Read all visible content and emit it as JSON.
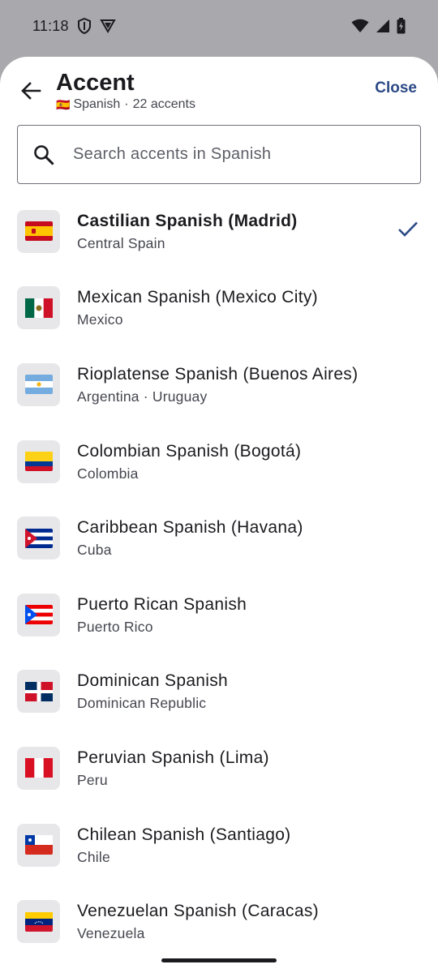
{
  "status_bar": {
    "time": "11:18",
    "icons": [
      "shield-icon",
      "vpn-icon",
      "wifi-icon",
      "cellular-signal-icon",
      "battery-icon"
    ]
  },
  "header": {
    "title": "Accent",
    "subtitle_flag": "🇪🇸",
    "subtitle_language": "Spanish",
    "subtitle_separator": "·",
    "subtitle_count": "22 accents",
    "close_label": "Close",
    "back_icon": "arrow-left-icon"
  },
  "search": {
    "placeholder": "Search accents in Spanish",
    "icon": "search-icon"
  },
  "accents": [
    {
      "flag": "es",
      "name": "Castilian Spanish (Madrid)",
      "region": "Central Spain",
      "selected": true
    },
    {
      "flag": "mx",
      "name": "Mexican Spanish (Mexico City)",
      "region": "Mexico",
      "selected": false
    },
    {
      "flag": "ar",
      "name": "Rioplatense Spanish (Buenos Aires)",
      "region": "Argentina · Uruguay",
      "selected": false
    },
    {
      "flag": "co",
      "name": "Colombian Spanish (Bogotá)",
      "region": "Colombia",
      "selected": false
    },
    {
      "flag": "cu",
      "name": "Caribbean Spanish (Havana)",
      "region": "Cuba",
      "selected": false
    },
    {
      "flag": "pr",
      "name": "Puerto Rican Spanish",
      "region": "Puerto Rico",
      "selected": false
    },
    {
      "flag": "do",
      "name": "Dominican Spanish",
      "region": "Dominican Republic",
      "selected": false
    },
    {
      "flag": "pe",
      "name": "Peruvian Spanish (Lima)",
      "region": "Peru",
      "selected": false
    },
    {
      "flag": "cl",
      "name": "Chilean Spanish (Santiago)",
      "region": "Chile",
      "selected": false
    },
    {
      "flag": "ve",
      "name": "Venezuelan Spanish (Caracas)",
      "region": "Venezuela",
      "selected": false
    }
  ],
  "colors": {
    "accent": "#2c4a86",
    "scrim": "#a9a9ad",
    "tile": "#e7e7ea"
  }
}
